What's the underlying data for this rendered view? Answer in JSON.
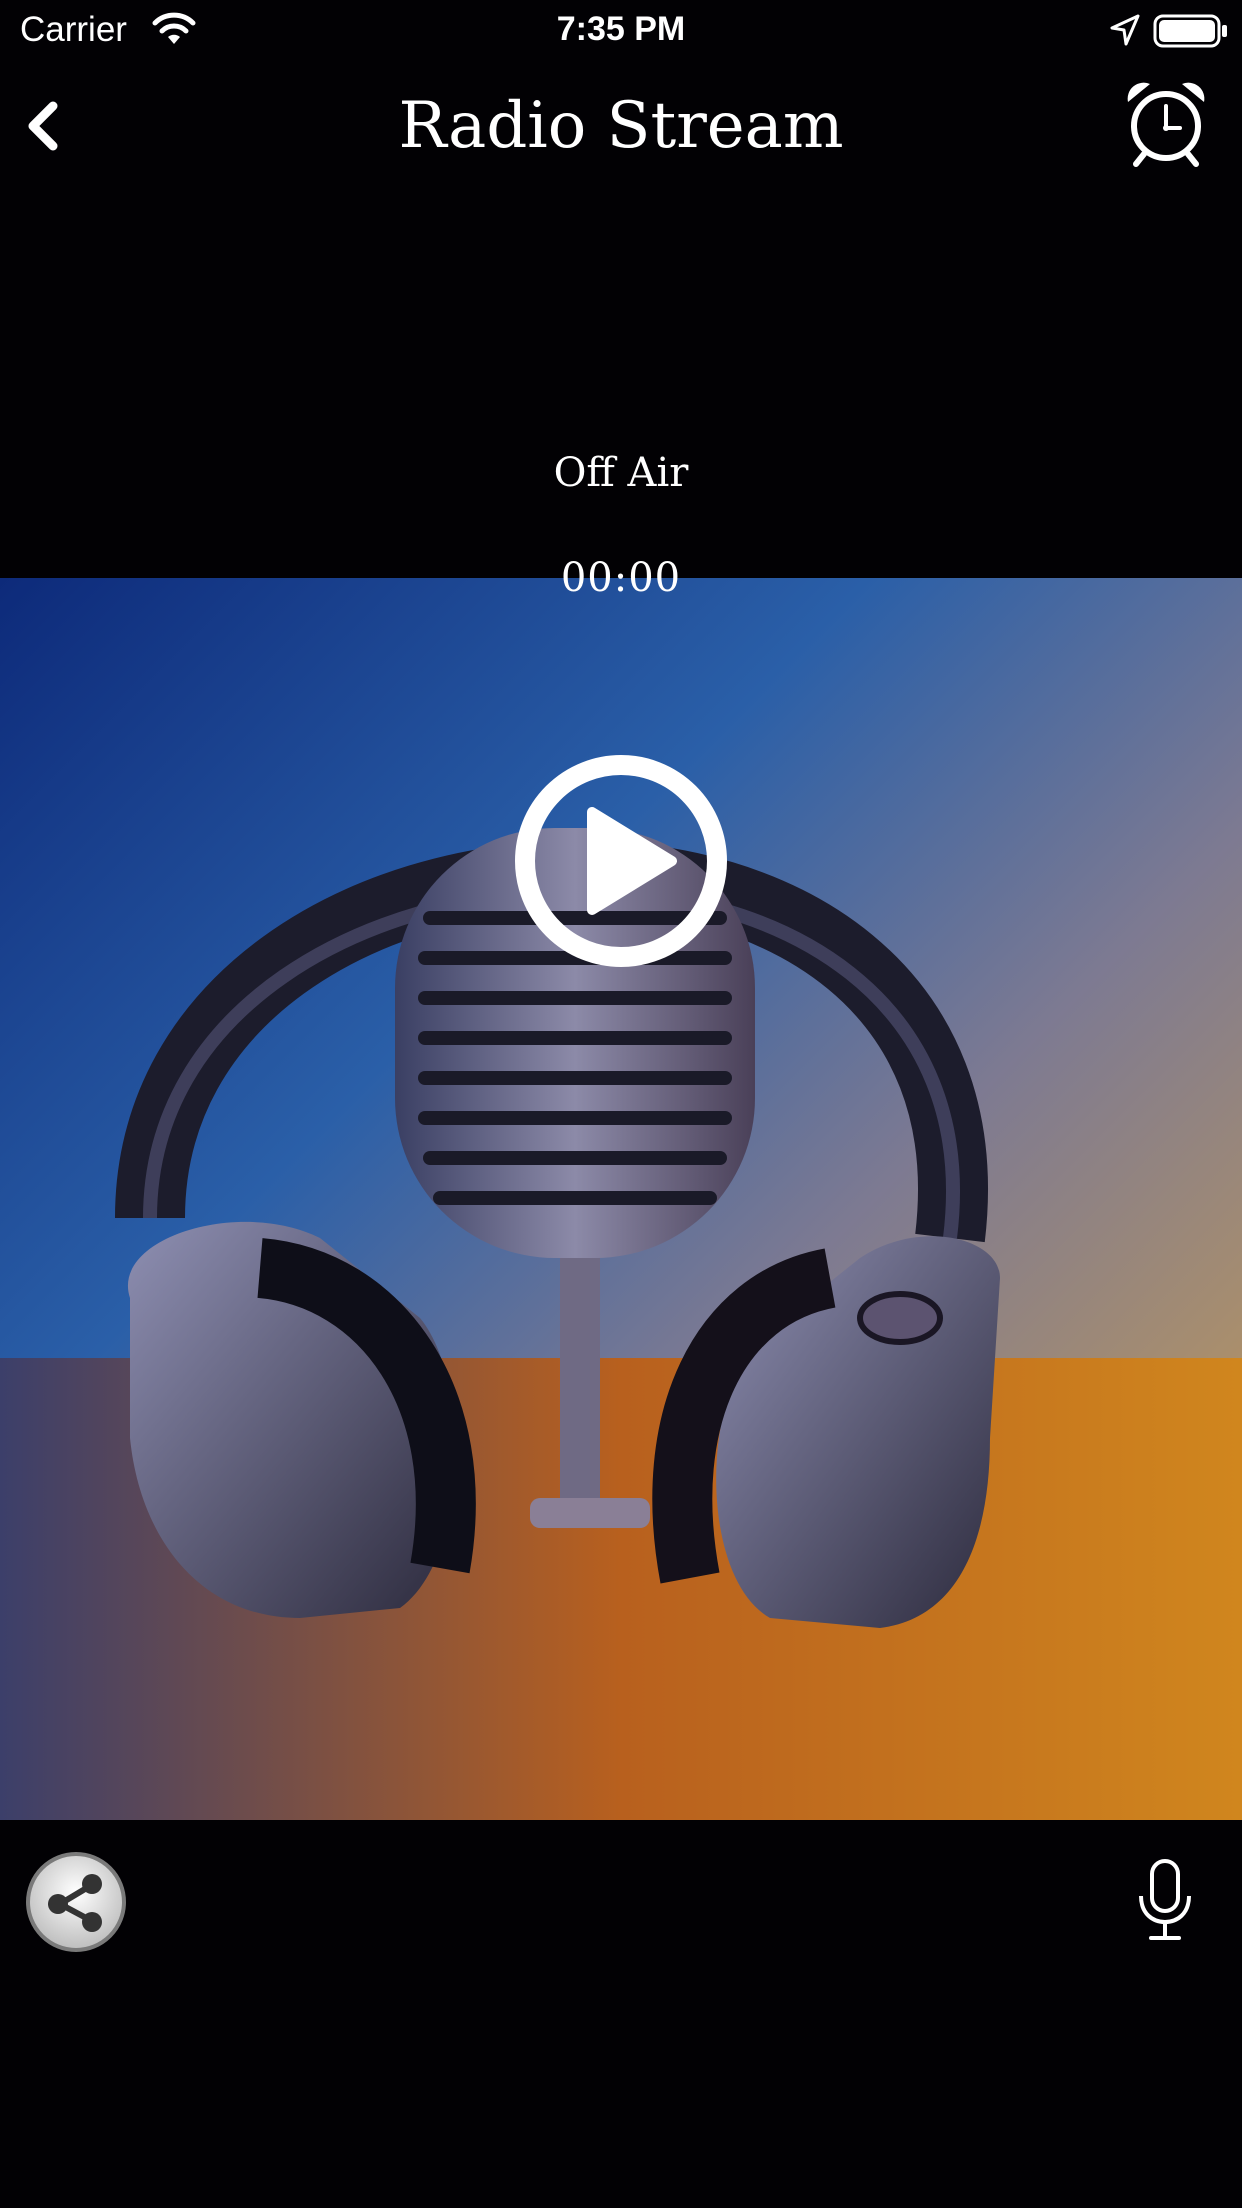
{
  "status_bar": {
    "carrier": "Carrier",
    "time": "7:35 PM",
    "icons": [
      "wifi-icon",
      "location-arrow-icon",
      "battery-icon"
    ]
  },
  "nav": {
    "title": "Radio Stream",
    "back_icon": "chevron-left-icon",
    "alarm_icon": "alarm-clock-icon"
  },
  "player": {
    "status_text": "Off Air",
    "elapsed": "00:00",
    "play_icon": "play-circle-icon",
    "artwork": "headphones-microphone-image"
  },
  "bottom_bar": {
    "share_icon": "share-icon",
    "mic_icon": "microphone-icon"
  },
  "colors": {
    "background": "#020104",
    "text": "#ffffff",
    "artwork_blue": "#1a3f8c",
    "artwork_orange": "#d07a1e"
  }
}
